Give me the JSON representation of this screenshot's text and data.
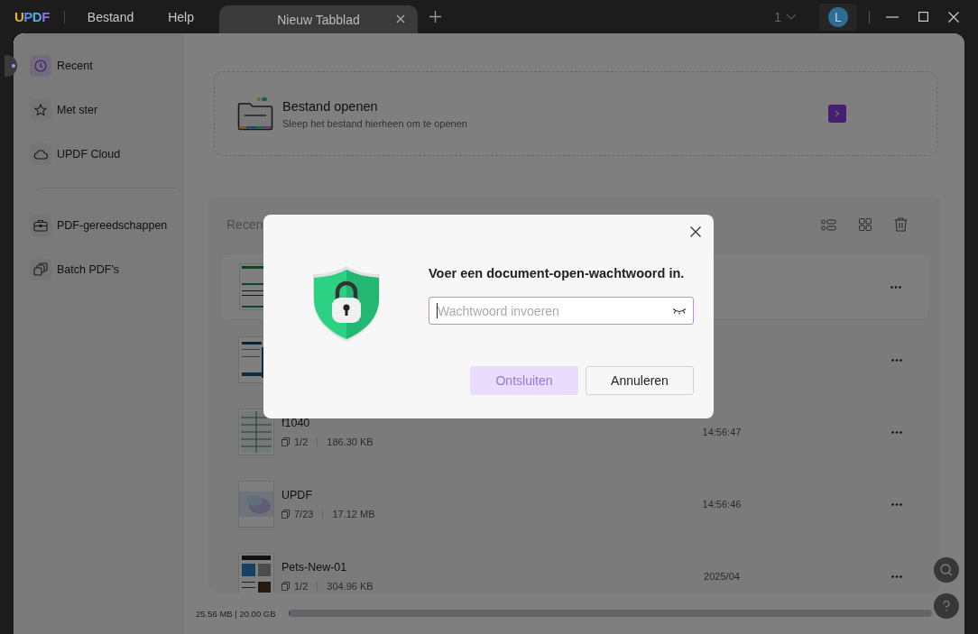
{
  "titlebar": {
    "logo": "UPDF",
    "menu": [
      "Bestand",
      "Help"
    ],
    "tabs": [
      {
        "label": "Nieuw Tabblad",
        "selected": true
      }
    ],
    "page_count": "1",
    "avatar": "L"
  },
  "sidebar": {
    "groups": [
      [
        {
          "label": "Recent",
          "selected": true
        },
        {
          "label": "Met ster",
          "selected": false
        },
        {
          "label": "UPDF Cloud",
          "selected": false
        }
      ],
      [
        {
          "label": "PDF-gereedschappen",
          "selected": false
        },
        {
          "label": "Batch PDF's",
          "selected": false
        }
      ]
    ]
  },
  "open_file": {
    "title": "Bestand openen",
    "subtitle": "Sleep het bestand hierheen om te openen"
  },
  "recent": {
    "heading": "Recen",
    "rows": [
      {
        "selected": true
      },
      {
        "selected": false
      },
      {
        "selected": false,
        "name": "f1040",
        "pages": "1/2",
        "size": "186.30 KB",
        "time": "14:56:47"
      },
      {
        "selected": false,
        "name": "UPDF",
        "pages": "7/23",
        "size": "17.12 MB",
        "time": "14:56:46"
      },
      {
        "selected": false,
        "name": "Pets-New-01",
        "pages": "1/2",
        "size": "304.96 KB",
        "time": "2025/04"
      }
    ]
  },
  "storage": {
    "text": "25.56 MB | 20.00 GB",
    "level": 0.0013
  },
  "dialog": {
    "title": "Voer een document-open-wachtwoord in.",
    "placeholder": "Wachtwoord invoeren",
    "buttons": [
      {
        "label": "Ontsluiten",
        "kind": "primary",
        "disabled": true
      },
      {
        "label": "Annuleren",
        "kind": "secondary",
        "disabled": false
      }
    ]
  }
}
